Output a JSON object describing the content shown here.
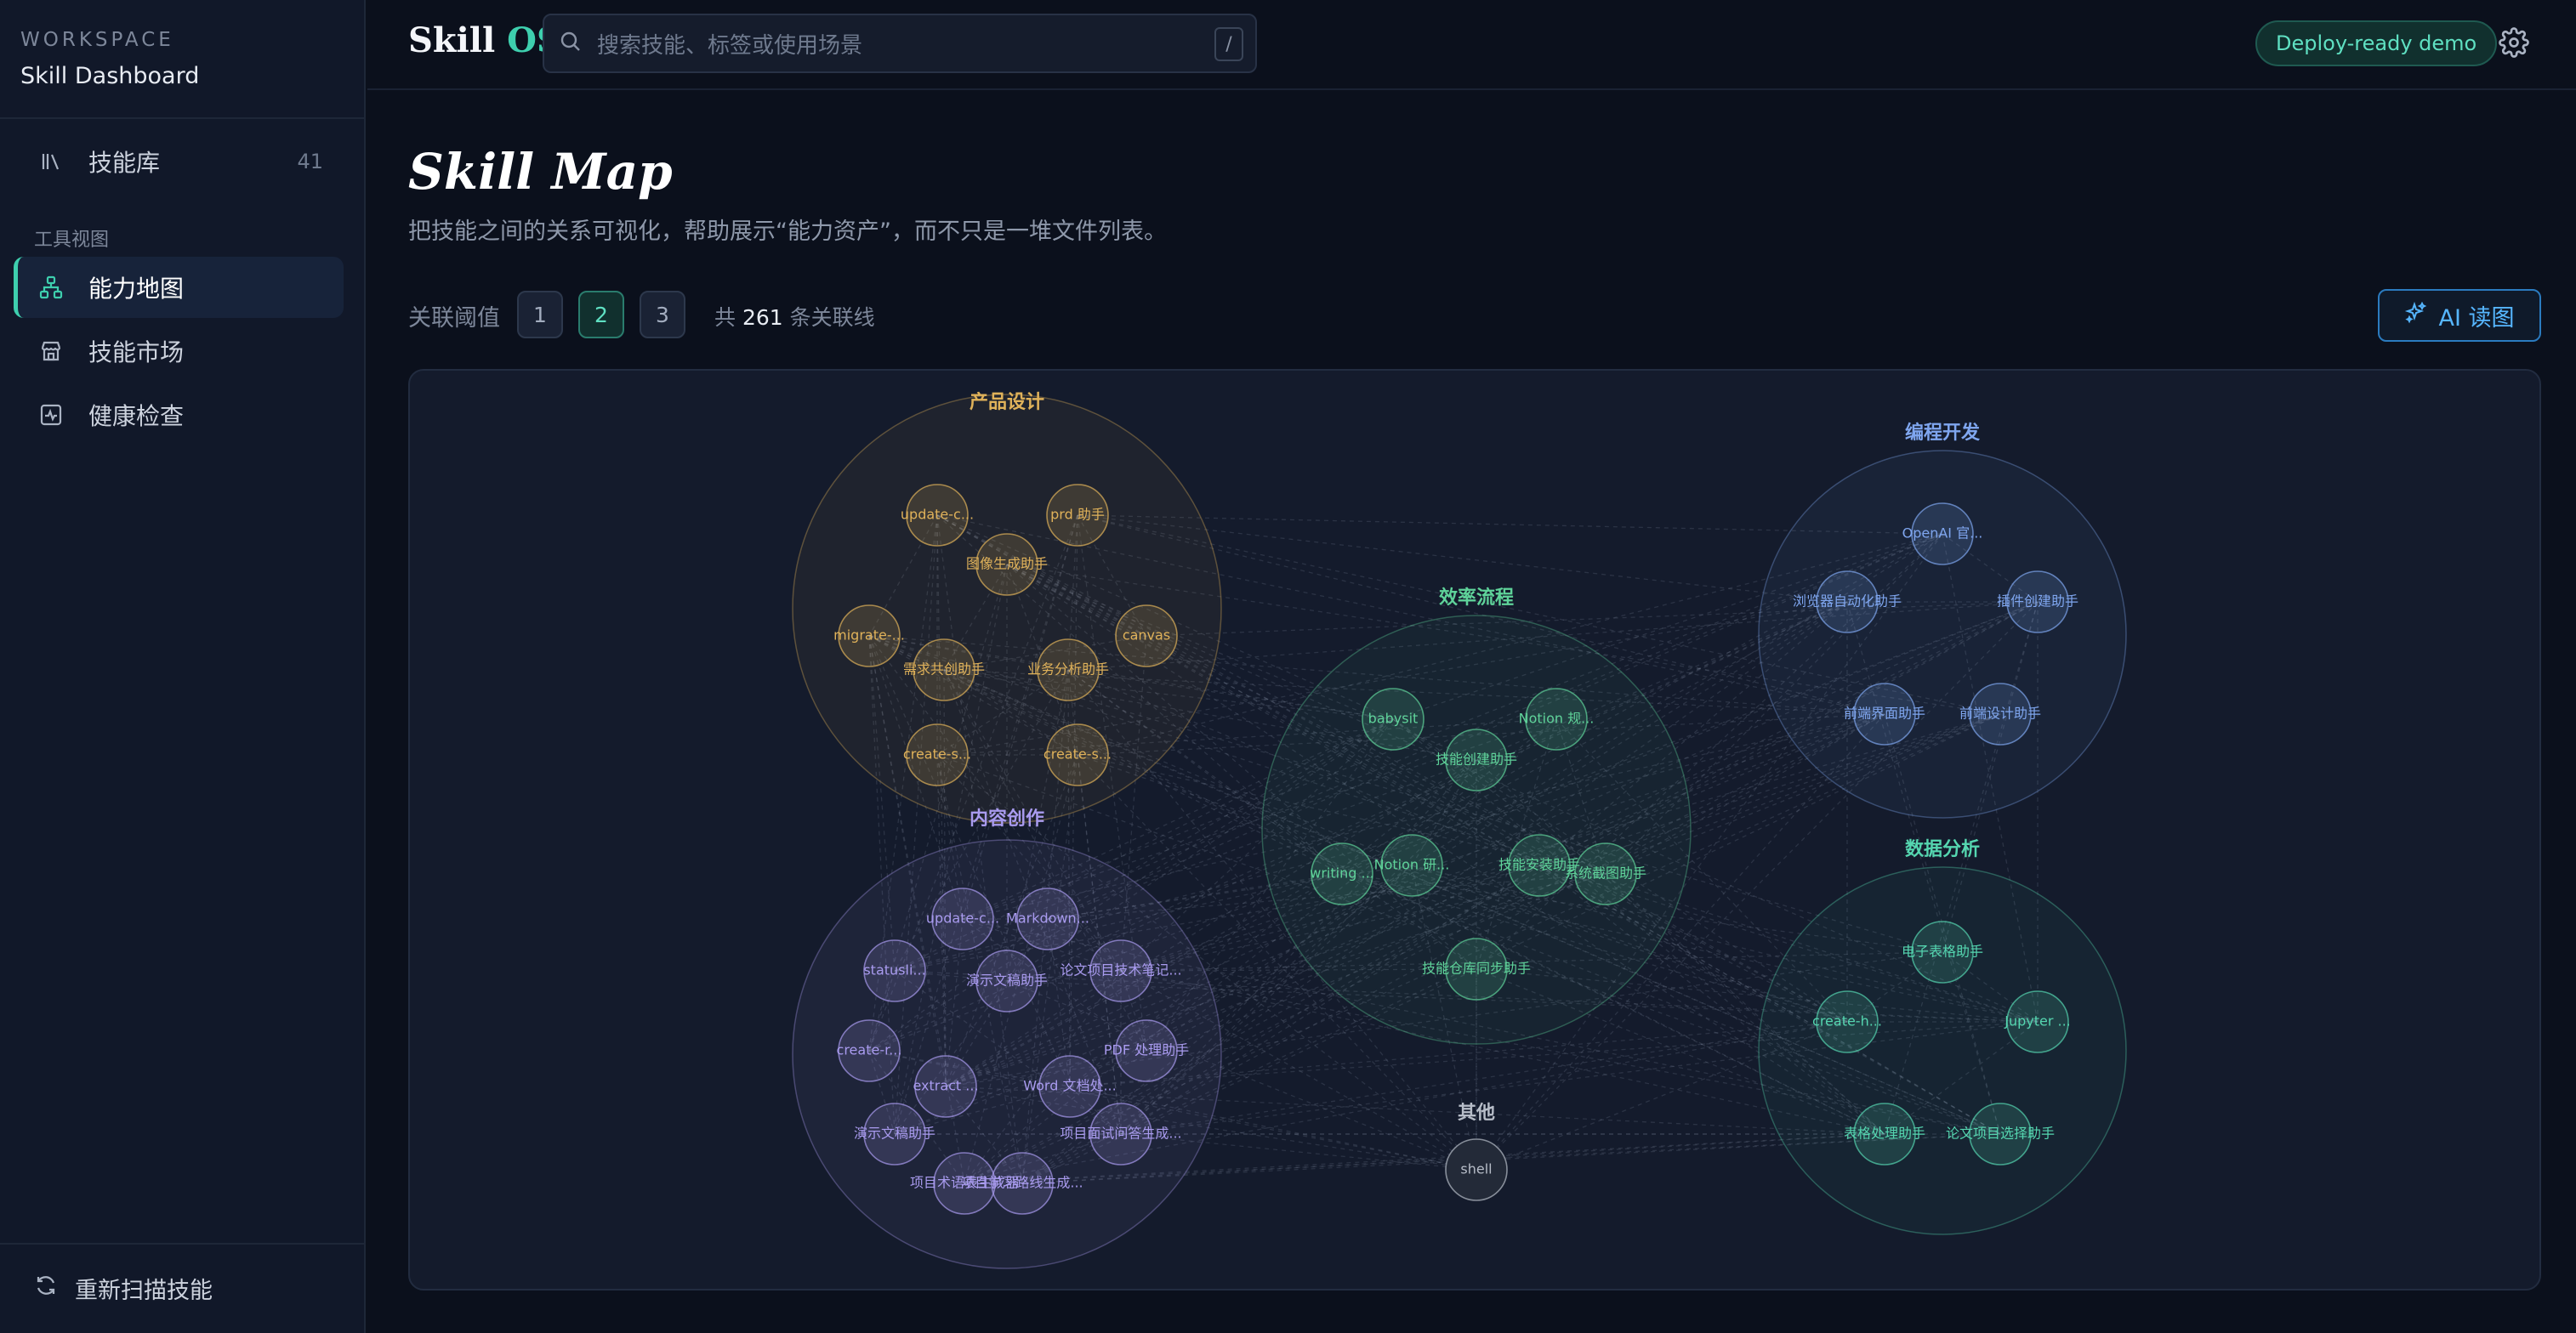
{
  "sidebar": {
    "workspace_label": "WORKSPACE",
    "workspace_title": "Skill Dashboard",
    "library": {
      "label": "技能库",
      "count": "41"
    },
    "section_label": "工具视图",
    "items": [
      {
        "label": "能力地图",
        "icon": "sitemap-icon",
        "active": true
      },
      {
        "label": "技能市场",
        "icon": "store-icon",
        "active": false
      },
      {
        "label": "健康检查",
        "icon": "activity-icon",
        "active": false
      }
    ],
    "rescan_label": "重新扫描技能"
  },
  "topbar": {
    "logo_main": "Skill ",
    "logo_accent": "OS",
    "search_placeholder": "搜索技能、标签或使用场景",
    "search_shortcut": "/",
    "deploy_badge": "Deploy-ready demo"
  },
  "main": {
    "title": "Skill Map",
    "subtitle": "把技能之间的关系可视化，帮助展示“能力资产”，而不只是一堆文件列表。",
    "threshold_label": "关联阈值",
    "thresholds": [
      "1",
      "2",
      "3"
    ],
    "active_threshold": "2",
    "link_prefix": "共",
    "link_count": "261",
    "link_suffix": "条关联线",
    "ai_button": "AI 读图"
  },
  "colors": {
    "accent": "#3ecfae",
    "product": "#e0b25a",
    "content": "#a99bef",
    "efficiency": "#5fd39a",
    "coding": "#7fa6ef",
    "data": "#55d6b0",
    "other": "#b7bdc8"
  },
  "clusters": [
    {
      "key": "product",
      "title": "产品设计",
      "nodes": [
        "update-c...",
        "prd 助手",
        "图像生成助手",
        "migrate-...",
        "canvas",
        "需求共创助手",
        "业务分析助手",
        "create-s...",
        "create-s..."
      ]
    },
    {
      "key": "content",
      "title": "内容创作",
      "nodes": [
        "update-c...",
        "Markdown...",
        "statusli...",
        "演示文稿助手",
        "论文项目技术笔记...",
        "create-r...",
        "PDF 处理助手",
        "extract ...",
        "Word 文档处...",
        "演示文稿助手",
        "项目面试问答生成...",
        "项目术语表生成器",
        "项目学习路线生成..."
      ]
    },
    {
      "key": "efficiency",
      "title": "效率流程",
      "nodes": [
        "babysit",
        "Notion 规...",
        "技能创建助手",
        "writing ...",
        "Notion 研...",
        "技能安装助手",
        "系统截图助手",
        "技能仓库同步助手"
      ]
    },
    {
      "key": "coding",
      "title": "编程开发",
      "nodes": [
        "OpenAI 官...",
        "浏览器自动化助手",
        "插件创建助手",
        "前端界面助手",
        "前端设计助手"
      ]
    },
    {
      "key": "data",
      "title": "数据分析",
      "nodes": [
        "电子表格助手",
        "create-h...",
        "Jupyter ...",
        "表格处理助手",
        "论文项目选择助手"
      ]
    },
    {
      "key": "other",
      "title": "其他",
      "nodes": [
        "shell"
      ]
    }
  ]
}
